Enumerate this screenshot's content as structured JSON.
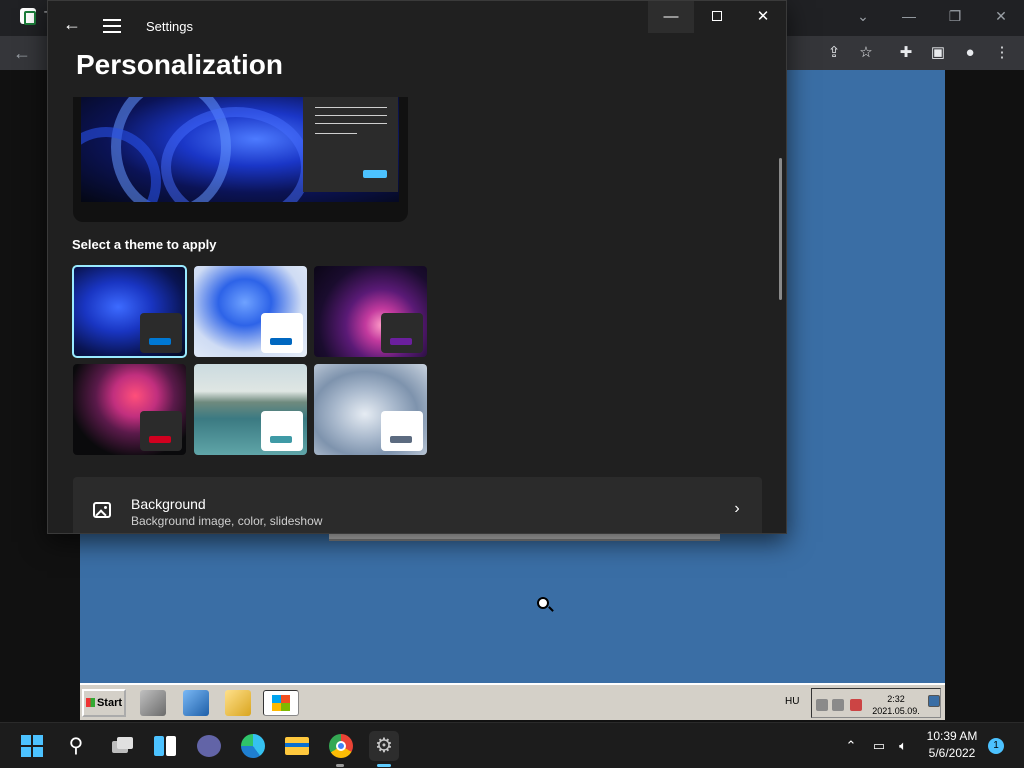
{
  "colors": {
    "accent": "#4cc2ff",
    "window_bg": "#202020",
    "card_bg": "#2b2b2b",
    "remote_desktop_bg": "#3a6ea5",
    "taskbar_bg": "#1c1c1c"
  },
  "browser": {
    "tab_title": "T",
    "icons": [
      "back-arrow-icon",
      "share-icon",
      "star-icon",
      "extensions-icon",
      "side-panel-icon",
      "profile-icon",
      "more-icon"
    ]
  },
  "remote_desktop": {
    "start_label": "Start",
    "language": "HU",
    "time": "2:32",
    "date": "2021.05.09."
  },
  "settings": {
    "window_title": "Settings",
    "page_title": "Personalization",
    "theme_section_label": "Select a theme to apply",
    "themes": [
      {
        "name": "theme-windows-dark",
        "selected": true,
        "accent": "#0078d4"
      },
      {
        "name": "theme-windows-light",
        "selected": false,
        "accent": "#0067c0"
      },
      {
        "name": "theme-glow",
        "selected": false,
        "accent": "#6b1f9e"
      },
      {
        "name": "theme-captured-motion",
        "selected": false,
        "accent": "#d1001f"
      },
      {
        "name": "theme-sunrise",
        "selected": false,
        "accent": "#3f9aa6"
      },
      {
        "name": "theme-flow",
        "selected": false,
        "accent": "#5c6b80"
      }
    ],
    "background_row": {
      "title": "Background",
      "subtitle": "Background image, color, slideshow"
    }
  },
  "taskbar": {
    "apps": [
      "start-icon",
      "search-icon",
      "task-view-icon",
      "widgets-icon",
      "teams-chat-icon",
      "edge-icon",
      "file-explorer-icon",
      "chrome-icon",
      "settings-icon"
    ],
    "time": "10:39 AM",
    "date": "5/6/2022",
    "notification_count": "1"
  }
}
